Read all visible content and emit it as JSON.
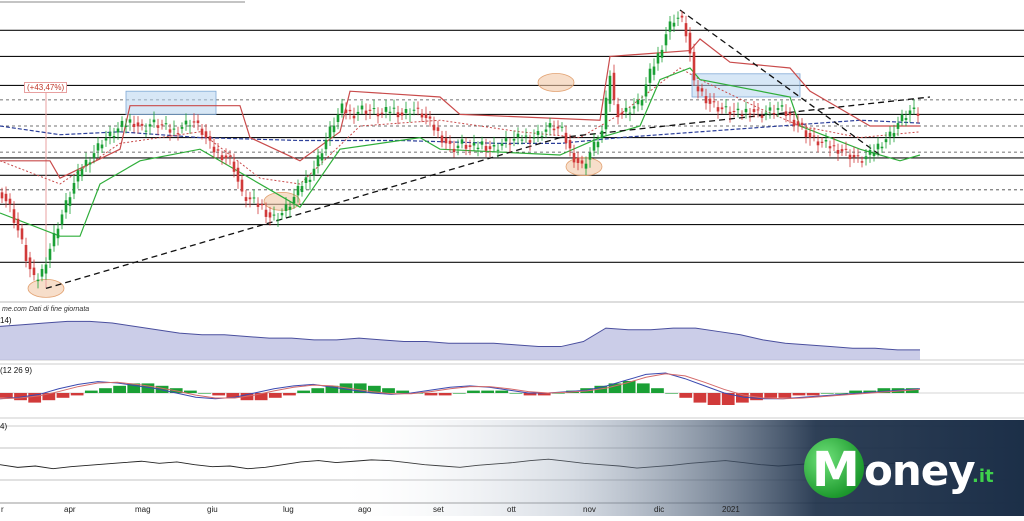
{
  "chart_data": [
    {
      "type": "candlestick",
      "source_text": "me.com  Dati di fine giornata",
      "percent_annotation": "(+43,47%)",
      "x_ticks": [
        "r",
        "apr",
        "mag",
        "giu",
        "lug",
        "ago",
        "set",
        "ott",
        "nov",
        "dic",
        "2021"
      ],
      "y_range": [
        0,
        100
      ],
      "grid": true,
      "resistance_levels": [
        93,
        84,
        74,
        64,
        56,
        49,
        43,
        33,
        26,
        13
      ],
      "dashed_levels": [
        69,
        60,
        51,
        38
      ],
      "close_path": [
        [
          0,
          38
        ],
        [
          10,
          32
        ],
        [
          20,
          22
        ],
        [
          28,
          12
        ],
        [
          35,
          6
        ],
        [
          42,
          10
        ],
        [
          50,
          18
        ],
        [
          58,
          26
        ],
        [
          66,
          33
        ],
        [
          74,
          40
        ],
        [
          82,
          46
        ],
        [
          92,
          50
        ],
        [
          102,
          55
        ],
        [
          112,
          57
        ],
        [
          122,
          60
        ],
        [
          132,
          62
        ],
        [
          142,
          59
        ],
        [
          152,
          61
        ],
        [
          162,
          60
        ],
        [
          172,
          58
        ],
        [
          182,
          60
        ],
        [
          192,
          62
        ],
        [
          202,
          58
        ],
        [
          212,
          52
        ],
        [
          222,
          50
        ],
        [
          232,
          48
        ],
        [
          242,
          36
        ],
        [
          252,
          34
        ],
        [
          262,
          32
        ],
        [
          272,
          28
        ],
        [
          282,
          30
        ],
        [
          292,
          34
        ],
        [
          302,
          40
        ],
        [
          312,
          44
        ],
        [
          322,
          52
        ],
        [
          332,
          60
        ],
        [
          342,
          66
        ],
        [
          352,
          64
        ],
        [
          362,
          66
        ],
        [
          372,
          65
        ],
        [
          382,
          64
        ],
        [
          392,
          66
        ],
        [
          402,
          64
        ],
        [
          412,
          66
        ],
        [
          422,
          64
        ],
        [
          432,
          60
        ],
        [
          442,
          56
        ],
        [
          452,
          52
        ],
        [
          462,
          54
        ],
        [
          472,
          52
        ],
        [
          482,
          54
        ],
        [
          492,
          52
        ],
        [
          502,
          54
        ],
        [
          512,
          55
        ],
        [
          522,
          56
        ],
        [
          532,
          56
        ],
        [
          542,
          58
        ],
        [
          552,
          60
        ],
        [
          562,
          58
        ],
        [
          572,
          50
        ],
        [
          582,
          46
        ],
        [
          592,
          52
        ],
        [
          602,
          58
        ],
        [
          610,
          78
        ],
        [
          615,
          66
        ],
        [
          620,
          64
        ],
        [
          630,
          66
        ],
        [
          640,
          68
        ],
        [
          650,
          78
        ],
        [
          660,
          86
        ],
        [
          668,
          94
        ],
        [
          676,
          98
        ],
        [
          682,
          96
        ],
        [
          688,
          90
        ],
        [
          694,
          74
        ],
        [
          700,
          72
        ],
        [
          710,
          68
        ],
        [
          720,
          66
        ],
        [
          730,
          65
        ],
        [
          740,
          64
        ],
        [
          750,
          66
        ],
        [
          760,
          64
        ],
        [
          770,
          65
        ],
        [
          780,
          66
        ],
        [
          790,
          63
        ],
        [
          800,
          60
        ],
        [
          810,
          56
        ],
        [
          820,
          54
        ],
        [
          830,
          53
        ],
        [
          840,
          52
        ],
        [
          850,
          50
        ],
        [
          860,
          48
        ],
        [
          870,
          50
        ],
        [
          880,
          54
        ],
        [
          890,
          57
        ],
        [
          900,
          62
        ],
        [
          910,
          65
        ],
        [
          920,
          64
        ]
      ],
      "bands": {
        "red": [
          [
            0,
            48
          ],
          [
            50,
            48
          ],
          [
            60,
            42
          ],
          [
            120,
            52
          ],
          [
            130,
            67
          ],
          [
            240,
            67
          ],
          [
            250,
            56
          ],
          [
            300,
            48
          ],
          [
            340,
            58
          ],
          [
            350,
            72
          ],
          [
            440,
            70
          ],
          [
            460,
            64
          ],
          [
            600,
            62
          ],
          [
            610,
            84
          ],
          [
            690,
            86
          ],
          [
            700,
            90
          ],
          [
            730,
            82
          ],
          [
            790,
            80
          ],
          [
            810,
            72
          ],
          [
            850,
            64
          ],
          [
            870,
            60
          ],
          [
            920,
            60
          ]
        ],
        "green": [
          [
            0,
            30
          ],
          [
            60,
            22
          ],
          [
            80,
            22
          ],
          [
            100,
            40
          ],
          [
            140,
            48
          ],
          [
            200,
            52
          ],
          [
            240,
            44
          ],
          [
            270,
            38
          ],
          [
            300,
            32
          ],
          [
            340,
            52
          ],
          [
            420,
            56
          ],
          [
            440,
            52
          ],
          [
            560,
            50
          ],
          [
            600,
            56
          ],
          [
            640,
            60
          ],
          [
            660,
            76
          ],
          [
            690,
            80
          ],
          [
            700,
            76
          ],
          [
            790,
            70
          ],
          [
            800,
            60
          ],
          [
            860,
            52
          ],
          [
            900,
            48
          ],
          [
            920,
            50
          ]
        ],
        "blue_dashed": [
          [
            0,
            60
          ],
          [
            60,
            57
          ],
          [
            120,
            58
          ],
          [
            200,
            56
          ],
          [
            300,
            55
          ],
          [
            400,
            55
          ],
          [
            500,
            54
          ],
          [
            560,
            54
          ],
          [
            620,
            56
          ],
          [
            700,
            58
          ],
          [
            780,
            60
          ],
          [
            860,
            62
          ],
          [
            920,
            61
          ]
        ],
        "red_dotted": [
          [
            0,
            48
          ],
          [
            60,
            40
          ],
          [
            120,
            54
          ],
          [
            200,
            58
          ],
          [
            260,
            42
          ],
          [
            300,
            40
          ],
          [
            360,
            60
          ],
          [
            440,
            62
          ],
          [
            520,
            58
          ],
          [
            580,
            56
          ],
          [
            620,
            64
          ],
          [
            680,
            80
          ],
          [
            700,
            76
          ],
          [
            760,
            66
          ],
          [
            800,
            60
          ],
          [
            860,
            56
          ],
          [
            920,
            58
          ]
        ]
      },
      "trendlines": [
        [
          [
            46,
            4
          ],
          [
            560,
            56
          ]
        ],
        [
          [
            560,
            56
          ],
          [
            930,
            70
          ]
        ],
        [
          [
            680,
            100
          ],
          [
            880,
            50
          ]
        ]
      ],
      "boxes": [
        {
          "x": [
            126,
            216
          ],
          "y": [
            64,
            72
          ]
        },
        {
          "x": [
            692,
            800
          ],
          "y": [
            70,
            78
          ]
        }
      ],
      "circles": [
        {
          "x": 46,
          "y": 4
        },
        {
          "x": 282,
          "y": 34
        },
        {
          "x": 556,
          "y": 75
        },
        {
          "x": 584,
          "y": 46
        }
      ]
    },
    {
      "type": "area",
      "label": "14)",
      "values": [
        40,
        42,
        44,
        46,
        46,
        44,
        40,
        36,
        32,
        30,
        30,
        28,
        26,
        26,
        24,
        24,
        26,
        24,
        22,
        22,
        20,
        20,
        20,
        18,
        16,
        16,
        22,
        38,
        36,
        36,
        38,
        38,
        34,
        30,
        24,
        20,
        18,
        16,
        14,
        14,
        12,
        12
      ]
    },
    {
      "type": "macd",
      "label": "(12 26 9)",
      "histogram": [
        -2,
        -3,
        -4,
        -3,
        -2,
        -1,
        1,
        2,
        3,
        4,
        4,
        3,
        2,
        1,
        0,
        -1,
        -2,
        -3,
        -3,
        -2,
        -1,
        1,
        2,
        3,
        4,
        4,
        3,
        2,
        1,
        0,
        -1,
        -1,
        0,
        1,
        1,
        1,
        0,
        -1,
        -1,
        0,
        1,
        2,
        3,
        4,
        5,
        4,
        2,
        0,
        -2,
        -4,
        -5,
        -5,
        -4,
        -3,
        -2,
        -2,
        -1,
        -1,
        0,
        0,
        1,
        1,
        2,
        2,
        2
      ],
      "line": [
        -4,
        -3,
        -1,
        3,
        6,
        8,
        7,
        5,
        3,
        0,
        -3,
        -4,
        -3,
        0,
        3,
        5,
        6,
        4,
        2,
        0,
        -1,
        0,
        2,
        4,
        5,
        4,
        2,
        0,
        0,
        1,
        2,
        5,
        9,
        13,
        14,
        10,
        5,
        0,
        -3,
        -4,
        -4,
        -3,
        -2,
        -1,
        0,
        1,
        2,
        3
      ]
    },
    {
      "type": "line",
      "label": "4)",
      "values": [
        52,
        48,
        50,
        46,
        49,
        51,
        53,
        55,
        57,
        54,
        56,
        52,
        49,
        50,
        46,
        48,
        52,
        56,
        58,
        55,
        57,
        59,
        58,
        55,
        52,
        50,
        48,
        51,
        53,
        55,
        58,
        60,
        57,
        54,
        52,
        50,
        47,
        49,
        51,
        54,
        56,
        58,
        55,
        52,
        50,
        52,
        54,
        50,
        48,
        51,
        53,
        55,
        52
      ]
    }
  ],
  "logo": {
    "m": "M",
    "rest": "oney",
    "it": ".it"
  },
  "colors": {
    "up": "#1aa035",
    "down": "#d13a3a",
    "red_band": "#c94b4b",
    "green_band": "#2fae3a",
    "blue_dashed": "#2c3f9a",
    "area_fill": "#b9bce0",
    "area_line": "#4a4f9e",
    "box": "#b6d3ef",
    "circle": "#f2c8a6",
    "dark_gradient": "#1c2f48"
  }
}
